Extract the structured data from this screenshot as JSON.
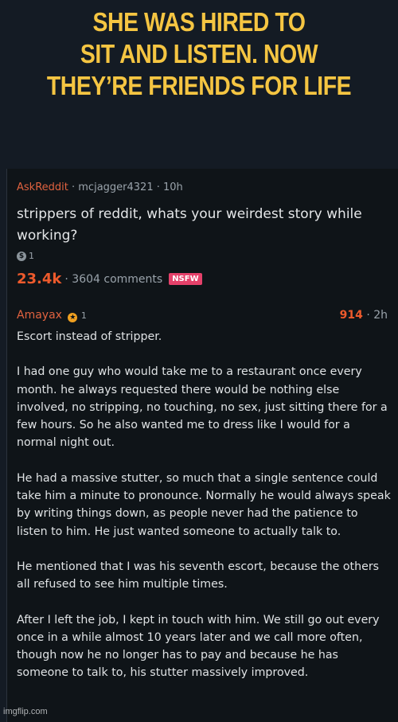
{
  "headline": {
    "line1": "SHE WAS HIRED TO",
    "line2": "SIT AND LISTEN. NOW",
    "line3": "THEY’RE FRIENDS FOR LIFE"
  },
  "post": {
    "subreddit": "AskReddit",
    "separator1": " · ",
    "user": "mcjagger4321",
    "separator2": " · ",
    "time": "10h",
    "title": "strippers of reddit, whats your weirdest story while working?",
    "award_count": "1",
    "score": "23.4k",
    "comments": "· 3604 comments",
    "nsfw_label": "NSFW"
  },
  "comment": {
    "author": "Amayax",
    "flair_count": "1",
    "score": "914",
    "time": "· 2h",
    "paragraphs": [
      "Escort instead of stripper.",
      "I had one guy who would take me to a restaurant once every month. he always requested there would be nothing else involved, no stripping, no touching, no sex, just sitting there for a few hours. So he also wanted me to dress like I would for a normal night out.",
      "He had a massive stutter, so much that a single sentence could take him a minute to pronounce. Normally he would always speak by writing things down, as people never had the patience to listen to him. He just wanted someone to actually talk to.",
      "He mentioned that I was his seventh escort, because the others all refused to see him multiple times.",
      "After I left the job, I kept in touch with him. We still go out every once in a while almost 10 years later and we call more often, though now he no longer has to pay and because he has someone to talk to, his stutter massively improved."
    ]
  },
  "watermark": "imgflip.com",
  "colors": {
    "headline": "#f5c542",
    "accent": "#ee5a2c",
    "nsfw": "#e5416a",
    "background": "#141b24"
  },
  "icons": {
    "award": "silver-award-icon",
    "flair": "star-flair-icon"
  }
}
